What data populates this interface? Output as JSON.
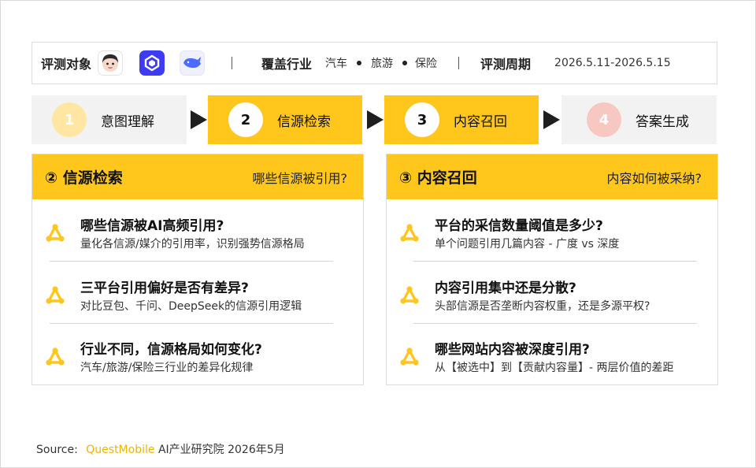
{
  "infobar": {
    "target_label": "评测对象",
    "industry_label": "覆盖行业",
    "industries": [
      "汽车",
      "旅游",
      "保险"
    ],
    "period_label": "评测周期",
    "period_value": "2026.5.11-2026.5.15",
    "logos": [
      "doubao-avatar-logo",
      "qianwen-logo",
      "deepseek-whale-logo"
    ]
  },
  "steps": [
    {
      "num": "1",
      "label": "意图理解",
      "state": "dim"
    },
    {
      "num": "2",
      "label": "信源检索",
      "state": "active"
    },
    {
      "num": "3",
      "label": "内容召回",
      "state": "active"
    },
    {
      "num": "4",
      "label": "答案生成",
      "state": "dim"
    }
  ],
  "panels": [
    {
      "title": "② 信源检索",
      "question": "哪些信源被引用?",
      "items": [
        {
          "title": "哪些信源被AI高频引用?",
          "sub": "量化各信源/媒介的引用率，识别强势信源格局"
        },
        {
          "title": "三平台引用偏好是否有差异?",
          "sub": "对比豆包、千问、DeepSeek的信源引用逻辑"
        },
        {
          "title": "行业不同，信源格局如何变化?",
          "sub": "汽车/旅游/保险三行业的差异化规律"
        }
      ]
    },
    {
      "title": "③ 内容召回",
      "question": "内容如何被采纳?",
      "items": [
        {
          "title": "平台的采信数量阈值是多少?",
          "sub": "单个问题引用几篇内容 -  广度 vs 深度"
        },
        {
          "title": "内容引用集中还是分散?",
          "sub": "头部信源是否垄断内容权重，还是多源平权?"
        },
        {
          "title": "哪些网站内容被深度引用?",
          "sub": "从【被选中】到【贡献内容量】- 两层价值的差距"
        }
      ]
    }
  ],
  "source": {
    "prefix": "Source:",
    "brand": "QuestMobile",
    "rest": "AI产业研究院 2026年5月"
  },
  "colors": {
    "accent": "#ffc61c",
    "step_dim": "#f2f2f2",
    "arrow": "#1f1f1f",
    "icon": "#ffc61c"
  }
}
